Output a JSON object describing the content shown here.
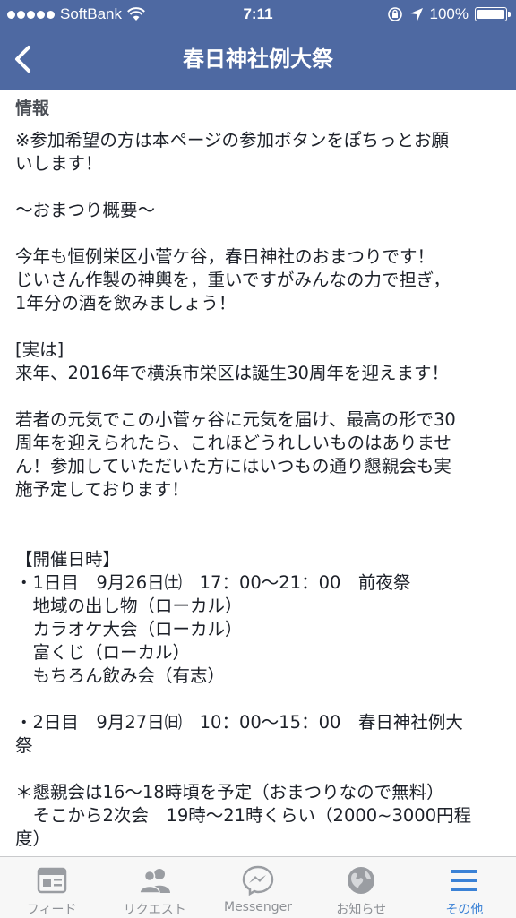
{
  "status_bar": {
    "carrier": "SoftBank",
    "time": "7:11",
    "battery_percent": "100%",
    "battery_level": 1.0,
    "wifi_icon": "wifi-icon",
    "location_icon": "location-arrow-icon",
    "lock_icon": "rotation-lock-icon"
  },
  "nav": {
    "title": "春日神社例大祭",
    "back_icon": "chevron-left-icon"
  },
  "colors": {
    "header_bg": "#4e69a2",
    "active_tab": "#3b82d6",
    "inactive_tab": "#8e9196"
  },
  "content": {
    "heading": "情報",
    "lines": [
      "※参加希望の方は本ページの参加ボタンをぽちっとお願",
      "いします！",
      "",
      "〜おまつり概要〜",
      "",
      "今年も恒例栄区小菅ケ谷，春日神社のおまつりです！",
      "じいさん作製の神輿を，重いですがみんなの力で担ぎ，",
      "1年分の酒を飲みましょう！",
      "",
      "[実は]",
      "来年、2016年で横浜市栄区は誕生30周年を迎えます！",
      "",
      "若者の元気でこの小菅ヶ谷に元気を届け、最高の形で30",
      "周年を迎えられたら、これほどうれしいものはありませ",
      "ん！参加していただいた方にはいつもの通り懇親会も実",
      "施予定しております！",
      "",
      "",
      "【開催日時】",
      "・1日目　9月26日㈯　17：00〜21：00　前夜祭",
      "　地域の出し物（ローカル）",
      "　カラオケ大会（ローカル）",
      "　富くじ（ローカル）",
      "　もちろん飲み会（有志）",
      "",
      "・2日目　9月27日㈰　10：00〜15：00　春日神社例大",
      "祭",
      "",
      "＊懇親会は16〜18時頃を予定（おまつりなので無料）",
      "　そこから2次会　19時〜21時くらい（2000~3000円程",
      "度）"
    ]
  },
  "tabbar": {
    "tabs": [
      {
        "label": "フィード",
        "icon": "feed-icon",
        "active": false
      },
      {
        "label": "リクエスト",
        "icon": "friend-requests-icon",
        "active": false
      },
      {
        "label": "Messenger",
        "icon": "messenger-icon",
        "active": false
      },
      {
        "label": "お知らせ",
        "icon": "notifications-globe-icon",
        "active": false
      },
      {
        "label": "その他",
        "icon": "more-menu-icon",
        "active": true
      }
    ]
  }
}
